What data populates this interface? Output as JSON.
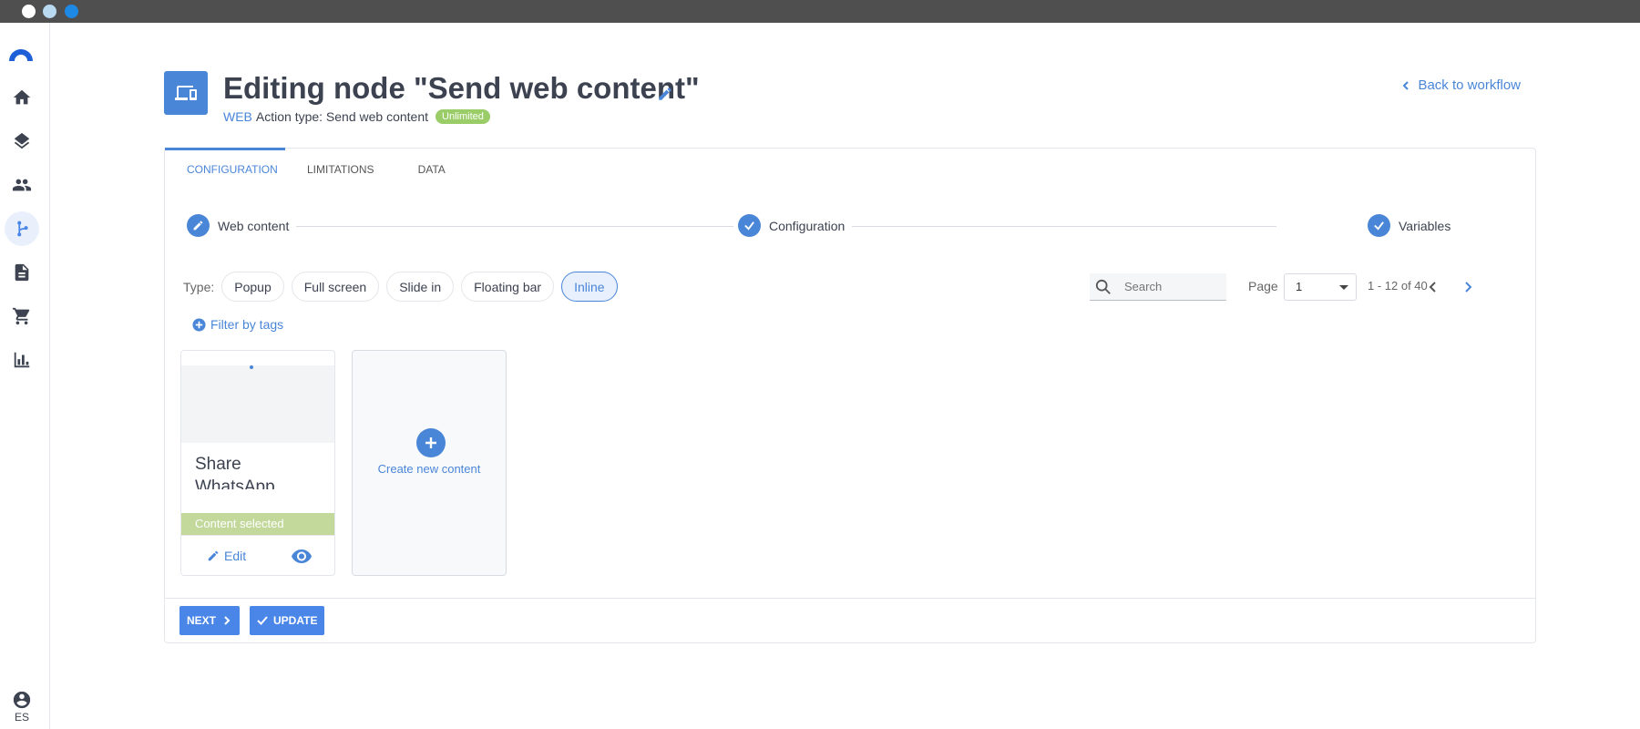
{
  "window": {
    "dot_colors": [
      "#ffffff",
      "#b9d9f1",
      "#1e88e5"
    ]
  },
  "sidebar": {
    "items": [
      {
        "name": "home-icon"
      },
      {
        "name": "layers-icon"
      },
      {
        "name": "people-icon"
      },
      {
        "name": "workflow-icon",
        "active": true
      },
      {
        "name": "document-icon"
      },
      {
        "name": "cart-icon"
      },
      {
        "name": "bar-chart-icon"
      }
    ],
    "user_lang": "ES"
  },
  "header": {
    "title": "Editing node \"Send web content\"",
    "channel": "WEB",
    "action_type": "Action type: Send web content",
    "badge": "Unlimited",
    "back_link": "Back to workflow"
  },
  "tabs": [
    {
      "label": "CONFIGURATION",
      "active": true
    },
    {
      "label": "LIMITATIONS"
    },
    {
      "label": "DATA"
    }
  ],
  "stepper": [
    {
      "label": "Web content",
      "icon": "pencil-icon"
    },
    {
      "label": "Configuration",
      "icon": "check-icon"
    },
    {
      "label": "Variables",
      "icon": "check-icon"
    }
  ],
  "filters": {
    "type_label": "Type:",
    "chips": [
      {
        "label": "Popup"
      },
      {
        "label": "Full screen"
      },
      {
        "label": "Slide in"
      },
      {
        "label": "Floating bar"
      },
      {
        "label": "Inline",
        "active": true
      }
    ],
    "search_placeholder": "Search",
    "page_label": "Page",
    "page_value": "1",
    "range": "1 - 12 of 40",
    "filter_tags": "Filter by tags"
  },
  "cards": [
    {
      "title": "Share WhatsApp",
      "selected_label": "Content selected",
      "edit_label": "Edit"
    }
  ],
  "create_card": {
    "label": "Create new content"
  },
  "footer": {
    "next_label": "NEXT",
    "update_label": "UPDATE"
  },
  "colors": {
    "accent": "#4a86d8",
    "badge": "#9acd68",
    "selected": "#c3d99c"
  }
}
